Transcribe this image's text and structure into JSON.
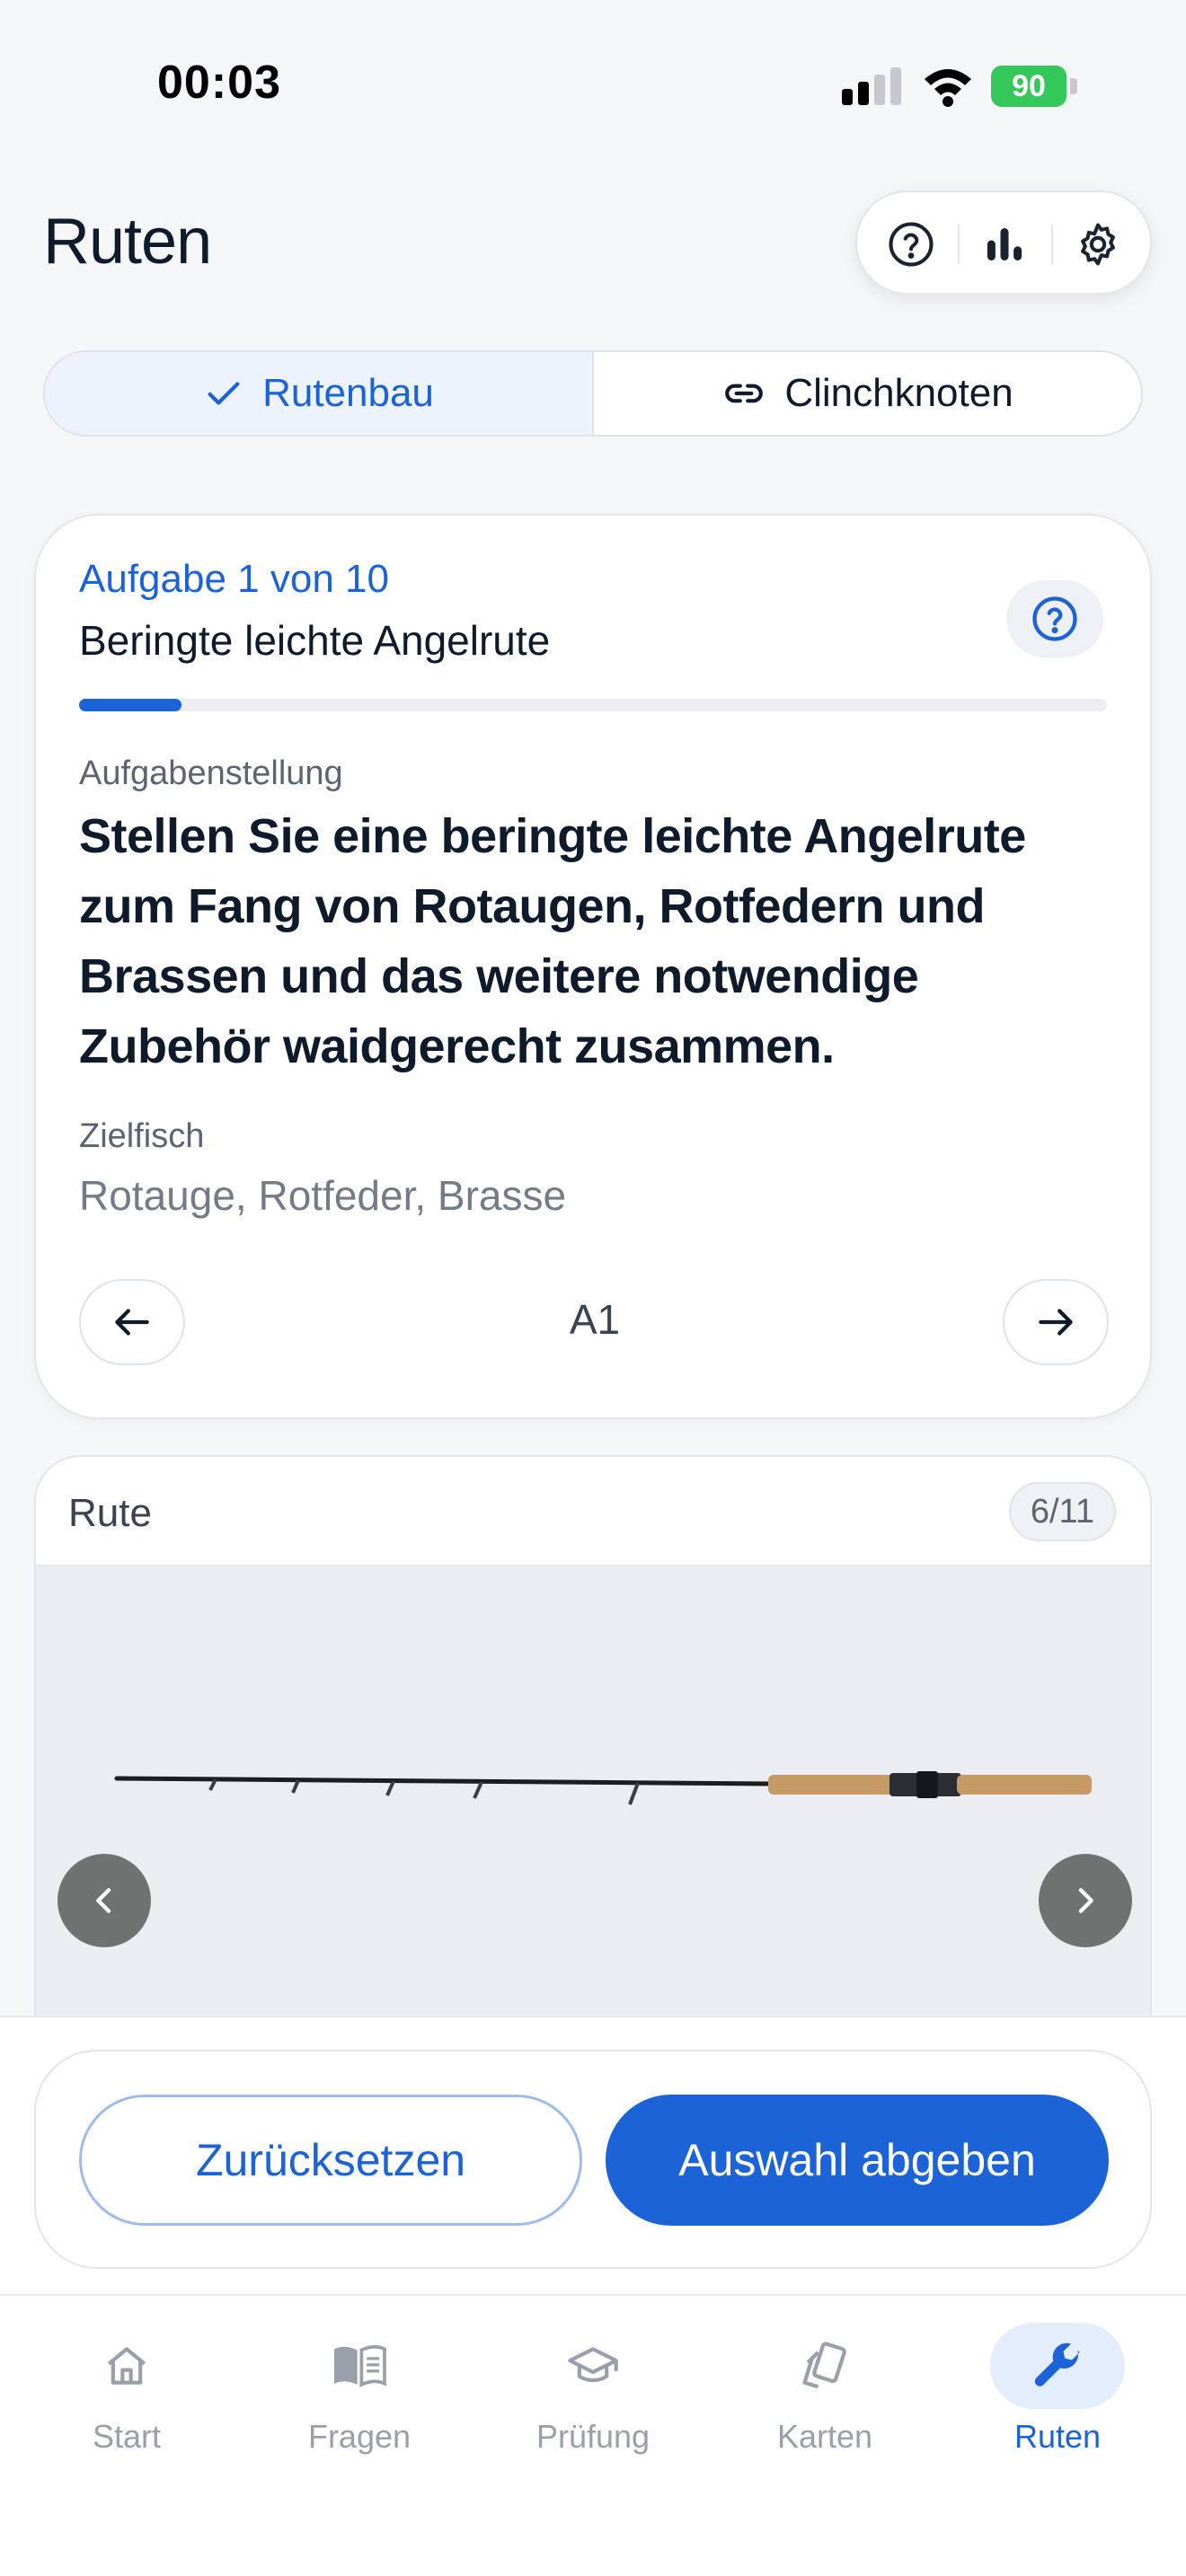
{
  "status_bar": {
    "time": "00:03",
    "battery": "90"
  },
  "header": {
    "title": "Ruten",
    "actions": [
      {
        "icon": "help-circle-icon"
      },
      {
        "icon": "bar-chart-icon"
      },
      {
        "icon": "gear-icon"
      }
    ]
  },
  "segments": [
    {
      "label": "Rutenbau",
      "icon": "check-icon",
      "active": true
    },
    {
      "label": "Clinchknoten",
      "icon": "link-icon",
      "active": false
    }
  ],
  "task": {
    "counter": "Aufgabe 1 von 10",
    "name": "Beringte leichte Angelrute",
    "progress": 0.1,
    "prompt_label": "Aufgabenstellung",
    "prompt": "Stellen Sie eine beringte leichte Angelrute zum Fang von Rotaugen, Rotfedern und Brassen und das weitere notwendige Zubehör waidgerecht zusammen.",
    "fish_label": "Zielfisch",
    "fish": "Rotauge, Rotfeder, Brasse",
    "code": "A1"
  },
  "rod_selector": {
    "title": "Rute",
    "count": "6/11"
  },
  "actions": {
    "reset_label": "Zurücksetzen",
    "submit_label": "Auswahl abgeben"
  },
  "tabs": [
    {
      "label": "Start",
      "icon": "home-icon",
      "active": false
    },
    {
      "label": "Fragen",
      "icon": "book-icon",
      "active": false
    },
    {
      "label": "Prüfung",
      "icon": "graduation-cap-icon",
      "active": false
    },
    {
      "label": "Karten",
      "icon": "cards-icon",
      "active": false
    },
    {
      "label": "Ruten",
      "icon": "wrench-icon",
      "active": true
    }
  ],
  "colors": {
    "accent": "#1b63d6",
    "battery": "#34c759"
  }
}
